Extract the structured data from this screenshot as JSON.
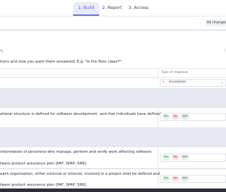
{
  "tabs": [
    {
      "label": "1. Build",
      "active": true
    },
    {
      "label": "2. Report",
      "active": false
    },
    {
      "label": "3. Access",
      "active": false
    }
  ],
  "save_status": "All changes s",
  "title_card": {
    "description": "tions and how you want them answered. E.g. \"Is the floor clean?\""
  },
  "table_header": {
    "type_of_response": "Type of response"
  },
  "annotation_row": {
    "response_label": "Annotation"
  },
  "questions": [
    {
      "lines": [
        "ational structure is defined for software development, and that individuals have defined"
      ],
      "responses": [
        "Yes",
        "No",
        "N/A"
      ]
    },
    {
      "lines": [
        "interrelation of personnel who manage, perform and verify work affecting software",
        "",
        "tware product assurance plan [PAF, SPAP; SRR]."
      ],
      "responses": [
        "Yes",
        "No",
        "N/A"
      ]
    },
    {
      "lines": [
        "each organisation, either external or internal, involved in a project shall be defined and",
        "",
        "tware product assurance plan [PAF, SPAP; SRR]."
      ],
      "responses": [
        "Yes",
        "No",
        "N/A"
      ]
    }
  ],
  "colors": {
    "accent": "#6570ea",
    "yes": "#2f8a4a",
    "no": "#c23a3a",
    "canvas": "#eceff6"
  }
}
